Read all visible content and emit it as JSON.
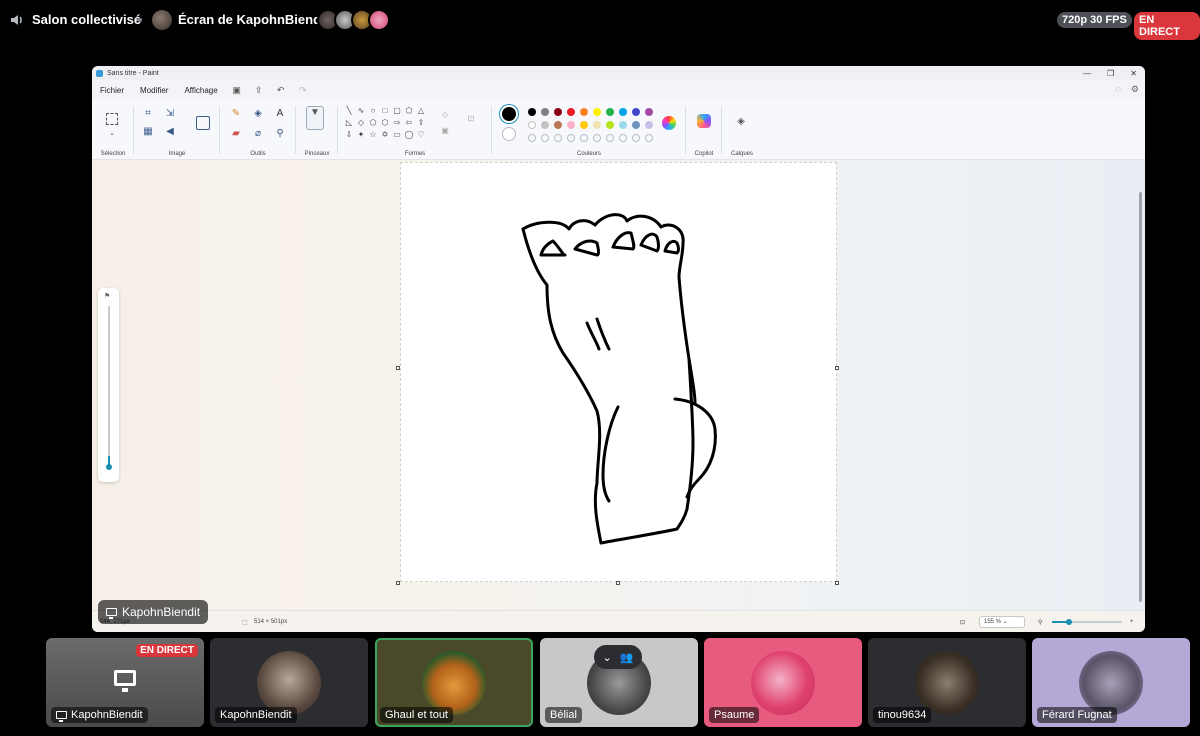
{
  "header": {
    "channel": "Salon collectivisé",
    "screen_title": "Écran de KapohnBiendit",
    "quality": "720p 30 FPS",
    "live": "EN DIRECT"
  },
  "paint": {
    "title": "Sans titre - Paint",
    "menu": [
      "Fichier",
      "Modifier",
      "Affichage"
    ],
    "groups": {
      "selection": "Sélection",
      "image": "Image",
      "tools": "Outils",
      "brushes": "Pinceaux",
      "shapes": "Formes",
      "colors": "Couleurs",
      "copilot": "Copilot",
      "layers": "Calques"
    },
    "palette_row1": [
      "#000000",
      "#7f7f7f",
      "#880015",
      "#ed1c24",
      "#ff7f27",
      "#fff200",
      "#22b14c",
      "#00a2e8",
      "#3f48cc",
      "#a349a4"
    ],
    "palette_row2": [
      "#ffffff",
      "#c3c3c3",
      "#b97a57",
      "#ffaec9",
      "#ffc90e",
      "#efe4b0",
      "#b5e61d",
      "#99d9ea",
      "#7092be",
      "#c8bfe7"
    ],
    "status": {
      "cursor": "344, 271px",
      "size": "514 × 501px",
      "zoom": "155 %"
    }
  },
  "streamer_chip": "KapohnBiendit",
  "participants": [
    {
      "name": "KapohnBiendit",
      "live": "EN DIRECT"
    },
    {
      "name": "KapohnBiendit"
    },
    {
      "name": "Ghaul et tout"
    },
    {
      "name": "Bélial"
    },
    {
      "name": "Psaume"
    },
    {
      "name": "tinou9634"
    },
    {
      "name": "Férard Fugnat"
    }
  ],
  "colors": {
    "live_red": "#da373c",
    "speaking_green": "#3ba55d",
    "accent_teal": "#1a8fb3"
  }
}
